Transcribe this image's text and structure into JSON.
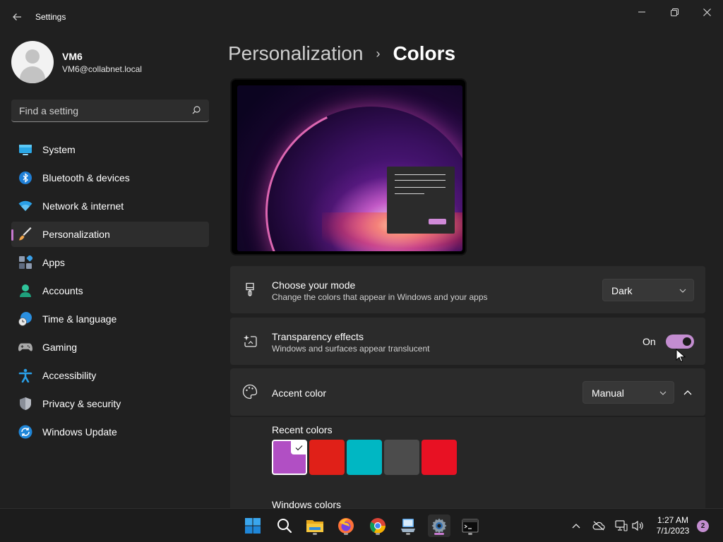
{
  "window": {
    "app_title": "Settings",
    "controls": [
      "minimize",
      "restore",
      "close"
    ]
  },
  "profile": {
    "name": "VM6",
    "email": "VM6@collabnet.local"
  },
  "search": {
    "placeholder": "Find a setting"
  },
  "sidebar": {
    "items": [
      {
        "label": "System",
        "icon": "system-icon"
      },
      {
        "label": "Bluetooth & devices",
        "icon": "bluetooth-icon"
      },
      {
        "label": "Network & internet",
        "icon": "wifi-icon"
      },
      {
        "label": "Personalization",
        "icon": "brush-icon",
        "active": true
      },
      {
        "label": "Apps",
        "icon": "apps-icon"
      },
      {
        "label": "Accounts",
        "icon": "accounts-icon"
      },
      {
        "label": "Time & language",
        "icon": "clock-globe-icon"
      },
      {
        "label": "Gaming",
        "icon": "gamepad-icon"
      },
      {
        "label": "Accessibility",
        "icon": "accessibility-icon"
      },
      {
        "label": "Privacy & security",
        "icon": "shield-icon"
      },
      {
        "label": "Windows Update",
        "icon": "update-icon"
      }
    ]
  },
  "breadcrumb": {
    "parent": "Personalization",
    "separator": "›",
    "current": "Colors"
  },
  "mode": {
    "title": "Choose your mode",
    "subtitle": "Change the colors that appear in Windows and your apps",
    "value": "Dark"
  },
  "transparency": {
    "title": "Transparency effects",
    "subtitle": "Windows and surfaces appear translucent",
    "state_label": "On",
    "enabled": true
  },
  "accent": {
    "title": "Accent color",
    "value": "Manual",
    "recent_label": "Recent colors",
    "windows_label": "Windows colors",
    "recent_colors": [
      "#b14fc4",
      "#e02018",
      "#00b7c3",
      "#4c4c4c",
      "#e81123"
    ],
    "selected_index": 0
  },
  "colors": {
    "accent": "#c38dd0",
    "background": "#202020",
    "card": "#2b2b2b"
  },
  "taskbar": {
    "apps": [
      "windows-start-icon",
      "search-icon",
      "file-explorer-icon",
      "firefox-icon",
      "chrome-icon",
      "remote-desktop-icon",
      "settings-icon",
      "terminal-icon"
    ],
    "time": "1:27 AM",
    "date": "7/1/2023",
    "notification_count": "2"
  }
}
